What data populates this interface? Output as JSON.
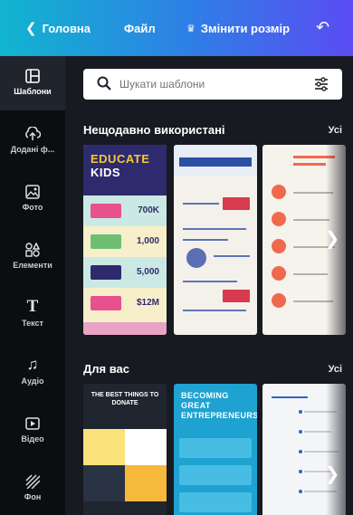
{
  "topbar": {
    "back_label": "Головна",
    "file_label": "Файл",
    "resize_label": "Змінити розмір",
    "back_icon": "chevron-left-icon",
    "undo_icon": "undo-icon"
  },
  "sidebar": {
    "items": [
      {
        "label": "Шаблони",
        "icon": "templates-icon",
        "active": true
      },
      {
        "label": "Додані ф...",
        "icon": "upload-icon",
        "active": false
      },
      {
        "label": "Фото",
        "icon": "photo-icon",
        "active": false
      },
      {
        "label": "Елементи",
        "icon": "elements-icon",
        "active": false
      },
      {
        "label": "Текст",
        "icon": "text-icon",
        "active": false
      },
      {
        "label": "Аудіо",
        "icon": "audio-icon",
        "active": false
      },
      {
        "label": "Відео",
        "icon": "video-icon",
        "active": false
      },
      {
        "label": "Фон",
        "icon": "background-icon",
        "active": false
      }
    ]
  },
  "search": {
    "placeholder": "Шукати шаблони"
  },
  "recent": {
    "title": "Нещодавно використані",
    "see_all": "Усі",
    "card1": {
      "title_line1": "EDUCATE",
      "title_line2": "KIDS",
      "stats": [
        "700K",
        "1,000",
        "5,000",
        "$12M"
      ]
    }
  },
  "for_you": {
    "title": "Для вас",
    "see_all": "Усі",
    "card1": {
      "title": "THE BEST THINGS TO DONATE"
    },
    "card2": {
      "title_line1": "BECOMING",
      "title_line2": "GREAT",
      "title_line3": "ENTREPRENEURS"
    }
  },
  "colors": {
    "topbar_gradient": [
      "#11b5cf",
      "#2f7ee6",
      "#5b4cf2"
    ],
    "sidebar_bg": "#0b0d11",
    "panel_bg": "#171a20"
  }
}
